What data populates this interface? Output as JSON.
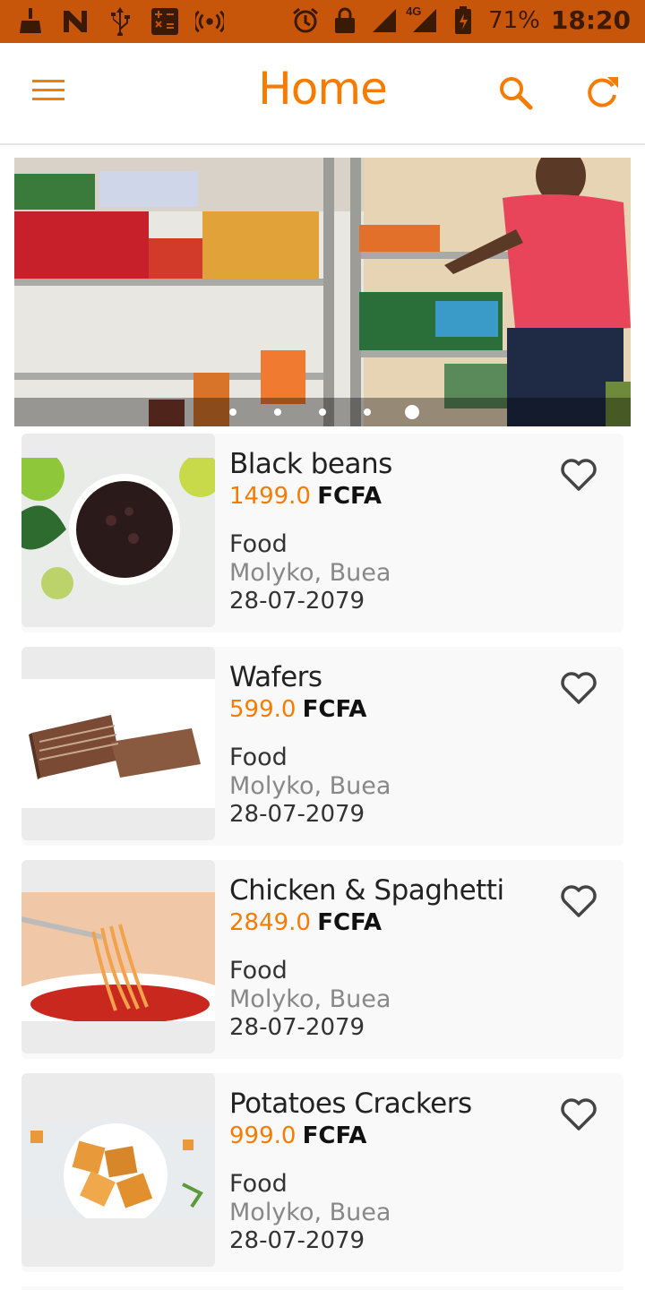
{
  "status_bar": {
    "battery": "71%",
    "time": "18:20",
    "network": "4G",
    "icons": [
      "broom-icon",
      "n-logo-icon",
      "usb-icon",
      "calculator-icon",
      "hotspot-icon",
      "alarm-icon",
      "lock-icon",
      "signal-icon",
      "signal-4g-icon",
      "battery-icon"
    ]
  },
  "app_bar": {
    "title": "Home",
    "icons": [
      "menu-icon",
      "search-icon",
      "refresh-icon"
    ]
  },
  "banner": {
    "slide_count": 5,
    "active_slide": 5
  },
  "colors": {
    "status_bar": "#c8560a",
    "accent": "#f57c00",
    "card_bg": "#f9f9f9"
  },
  "products": [
    {
      "name": "Black beans",
      "price": "1499.0",
      "currency": "FCFA",
      "category": "Food",
      "location": "Molyko, Buea",
      "date": "28-07-2079"
    },
    {
      "name": "Wafers",
      "price": "599.0",
      "currency": "FCFA",
      "category": "Food",
      "location": "Molyko, Buea",
      "date": "28-07-2079"
    },
    {
      "name": "Chicken & Spaghetti",
      "price": "2849.0",
      "currency": "FCFA",
      "category": "Food",
      "location": "Molyko, Buea",
      "date": "28-07-2079"
    },
    {
      "name": "Potatoes Crackers",
      "price": "999.0",
      "currency": "FCFA",
      "category": "Food",
      "location": "Molyko, Buea",
      "date": "28-07-2079"
    }
  ]
}
